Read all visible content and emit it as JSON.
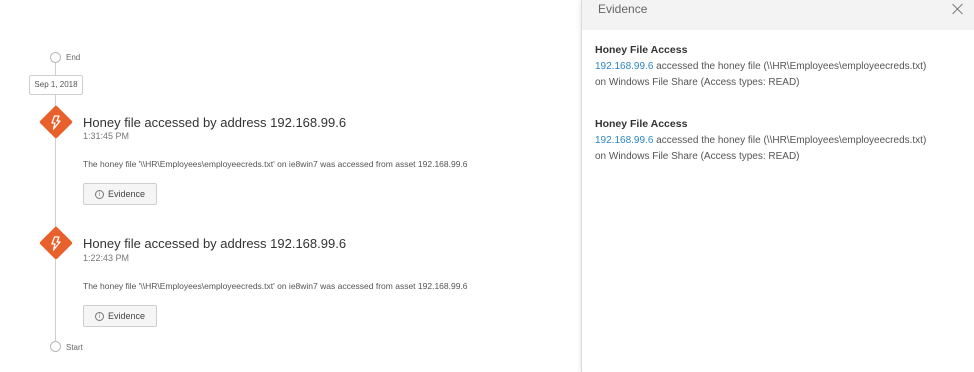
{
  "timeline": {
    "end_label": "End",
    "start_label": "Start",
    "date": "Sep 1, 2018",
    "events": [
      {
        "title": "Honey file accessed by address 192.168.99.6",
        "time": "1:31:45 PM",
        "description": "The honey file '\\\\HR\\Employees\\employeecreds.txt' on ie8win7 was accessed from asset 192.168.99.6",
        "button_label": "Evidence",
        "icon": "lightning-icon"
      },
      {
        "title": "Honey file accessed by address 192.168.99.6",
        "time": "1:22:43 PM",
        "description": "The honey file '\\\\HR\\Employees\\employeecreds.txt' on ie8win7 was accessed from asset 192.168.99.6",
        "button_label": "Evidence",
        "icon": "lightning-icon"
      }
    ]
  },
  "panel": {
    "title": "Evidence",
    "items": [
      {
        "title": "Honey File Access",
        "ip": "192.168.99.6",
        "text_line1": " accessed the honey file (\\\\HR\\Employees\\employeecreds.txt)",
        "text_line2": "on Windows File Share (Access types: READ)"
      },
      {
        "title": "Honey File Access",
        "ip": "192.168.99.6",
        "text_line1": " accessed the honey file (\\\\HR\\Employees\\employeecreds.txt)",
        "text_line2": "on Windows File Share (Access types: READ)"
      }
    ]
  },
  "colors": {
    "accent_orange": "#e8602c",
    "link_blue": "#2a86c8",
    "panel_header_bg": "#f3f3f3"
  }
}
